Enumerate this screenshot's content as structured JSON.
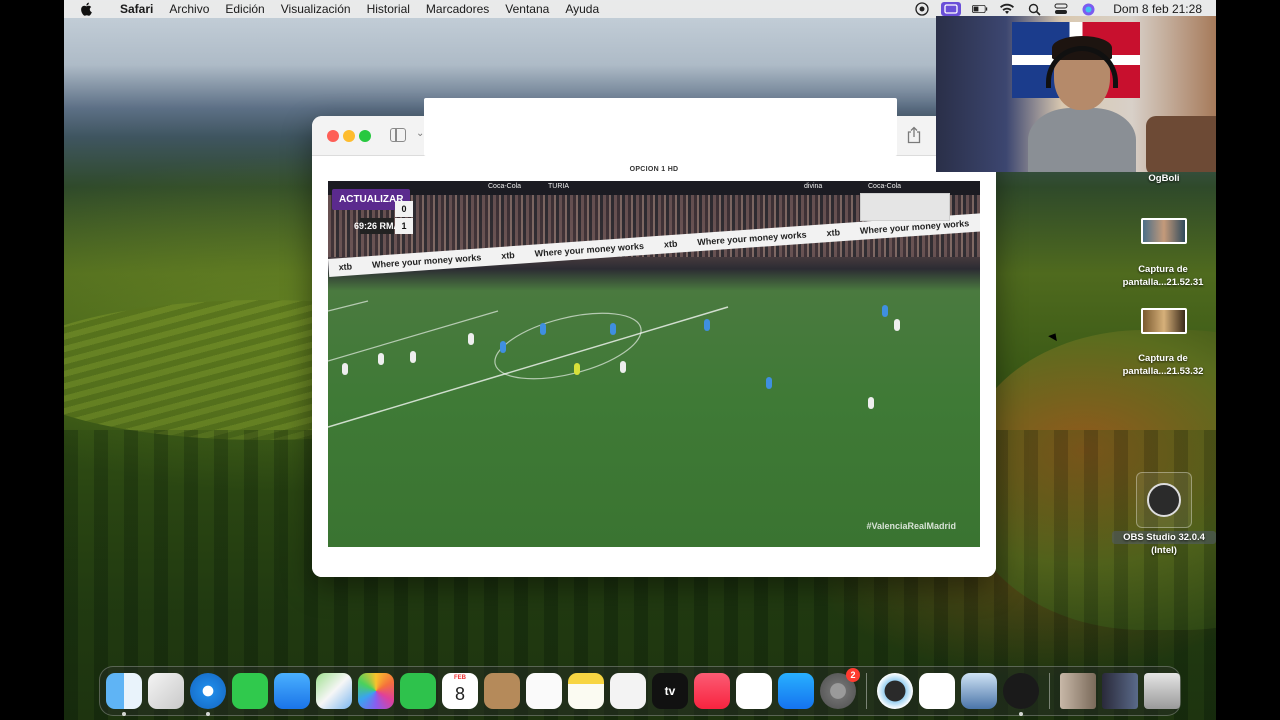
{
  "menubar": {
    "app_name": "Safari",
    "items": [
      "Archivo",
      "Edición",
      "Visualización",
      "Historial",
      "Marcadores",
      "Ventana",
      "Ayuda"
    ],
    "clock": "Dom 8 feb 21:28",
    "status_icons": [
      "focus-icon",
      "screen-recording-icon",
      "battery-icon",
      "wifi-icon",
      "spotlight-icon",
      "control-center-icon",
      "siri-icon"
    ]
  },
  "browser": {
    "option_title": "OPCION 1 HD",
    "player": {
      "refresh_label": "ACTUALIZAR",
      "score_home": "0",
      "score_away": "1",
      "clock": "69:26",
      "away_team": "RMA",
      "hashtag": "#ValenciaRealMadrid",
      "ad_text": "Where your money works",
      "ad_brand": "xtb",
      "top_ads": [
        "Coca-Cola",
        "TURIA",
        "divina",
        "Coca-Cola"
      ]
    }
  },
  "webcam": {
    "name": "OgBoli"
  },
  "desktop": {
    "files": [
      {
        "line1": "Captura de",
        "line2": "pantalla...21.52.31"
      },
      {
        "line1": "Captura de",
        "line2": "pantalla...21.53.32"
      }
    ],
    "obs": {
      "line1": "OBS Studio 32.0.4",
      "line2": "(Intel)"
    }
  },
  "dock": {
    "calendar": {
      "month": "FEB",
      "day": "8"
    },
    "tv_label": "tv",
    "settings_badge": "2"
  }
}
